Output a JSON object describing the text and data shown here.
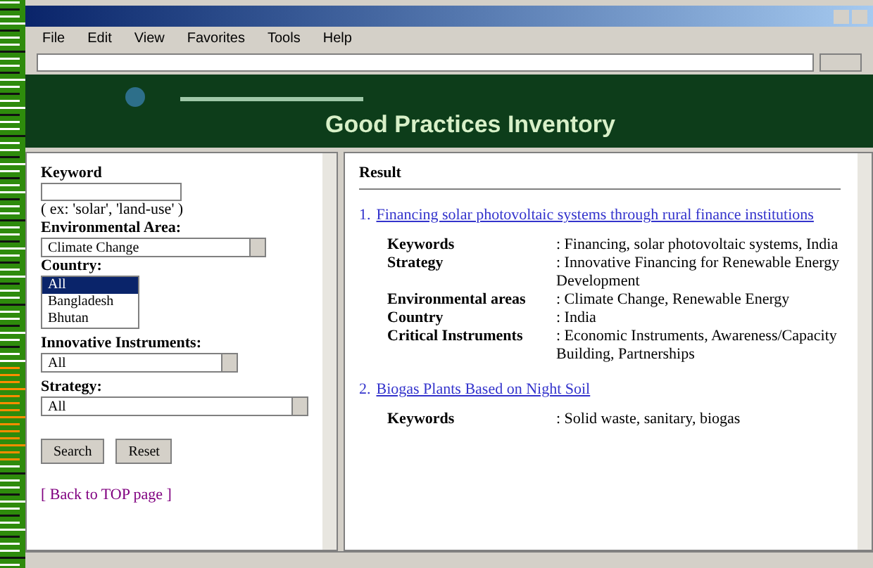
{
  "menu": [
    "File",
    "Edit",
    "View",
    "Favorites",
    "Tools",
    "Help"
  ],
  "header": {
    "title": "Good Practices Inventory"
  },
  "search": {
    "keyword_label": "Keyword",
    "hint": "( ex: 'solar', 'land-use' )",
    "env_label": "Environmental Area:",
    "env_value": "Climate Change",
    "country_label": "Country:",
    "countries": [
      {
        "label": "All",
        "selected": true
      },
      {
        "label": "Bangladesh",
        "selected": false
      },
      {
        "label": "Bhutan",
        "selected": false
      }
    ],
    "instr_label": "Innovative Instruments:",
    "instr_value": "All",
    "strategy_label": "Strategy:",
    "strategy_value": "All",
    "buttons": [
      "Search",
      "Reset"
    ],
    "back_link": "[ Back to TOP page ]"
  },
  "result": {
    "heading": "Result",
    "items": [
      {
        "number": "1.",
        "title": "Financing solar photovoltaic systems through rural finance institutions",
        "fields": [
          {
            "label": "Keywords",
            "value": ": Financing, solar photovoltaic systems, India"
          },
          {
            "label": "Strategy",
            "value": ": Innovative Financing for Renewable Energy Development"
          },
          {
            "label": "Environmental areas",
            "value": ": Climate Change, Renewable Energy"
          },
          {
            "label": "Country",
            "value": ": India"
          },
          {
            "label": "Critical Instruments",
            "value": ": Economic Instruments, Awareness/Capacity Building, Partnerships"
          }
        ]
      },
      {
        "number": "2.",
        "title": "Biogas Plants Based on Night Soil",
        "fields": [
          {
            "label": "Keywords",
            "value": ": Solid waste, sanitary, biogas"
          }
        ]
      }
    ]
  }
}
